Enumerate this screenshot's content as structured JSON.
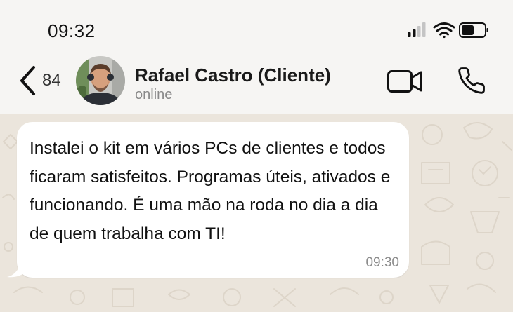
{
  "status_bar": {
    "time": "09:32",
    "icons": [
      "cellular-signal-icon",
      "wifi-icon",
      "battery-icon"
    ]
  },
  "header": {
    "back_count": "84",
    "contact_name": "Rafael Castro (Cliente)",
    "contact_status": "online",
    "icons": [
      "chevron-left-icon",
      "video-camera-icon",
      "phone-icon"
    ]
  },
  "message": {
    "text": "Instalei o kit em vários PCs de clientes e todos ficaram satisfeitos. Programas úteis, ativados e funcionando. É uma mão na roda no dia a dia de quem trabalha com TI!",
    "time": "09:30"
  },
  "colors": {
    "header_bg": "#f6f5f3",
    "chat_bg": "#ebe5dc",
    "bubble_bg": "#ffffff",
    "text": "#111111",
    "muted": "#8a8a8a"
  }
}
